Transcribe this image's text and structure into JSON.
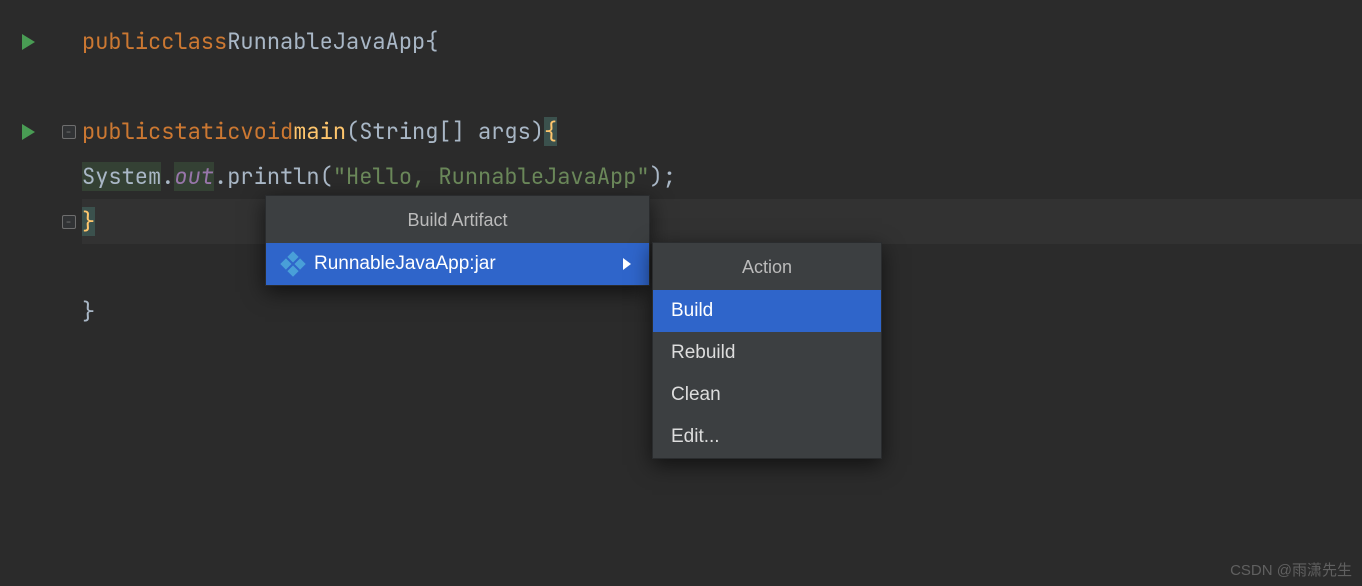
{
  "code": {
    "line1": {
      "kw1": "public",
      "kw2": "class",
      "cls": "RunnableJavaApp",
      "brace": "{"
    },
    "line3": {
      "kw1": "public",
      "kw2": "static",
      "kw3": "void",
      "fn": "main",
      "sig": "(String[] args)",
      "brace": "{"
    },
    "line4": {
      "sys": "System",
      "dot1": ".",
      "out": "out",
      "dot2": ".",
      "println": "println(",
      "str": "\"Hello, RunnableJavaApp\"",
      "close": ");"
    },
    "line5": {
      "brace": "}"
    },
    "line7": {
      "brace": "}"
    }
  },
  "menu1": {
    "title": "Build Artifact",
    "item": "RunnableJavaApp:jar"
  },
  "menu2": {
    "title": "Action",
    "items": [
      "Build",
      "Rebuild",
      "Clean",
      "Edit..."
    ]
  },
  "watermark": "CSDN @雨潇先生"
}
